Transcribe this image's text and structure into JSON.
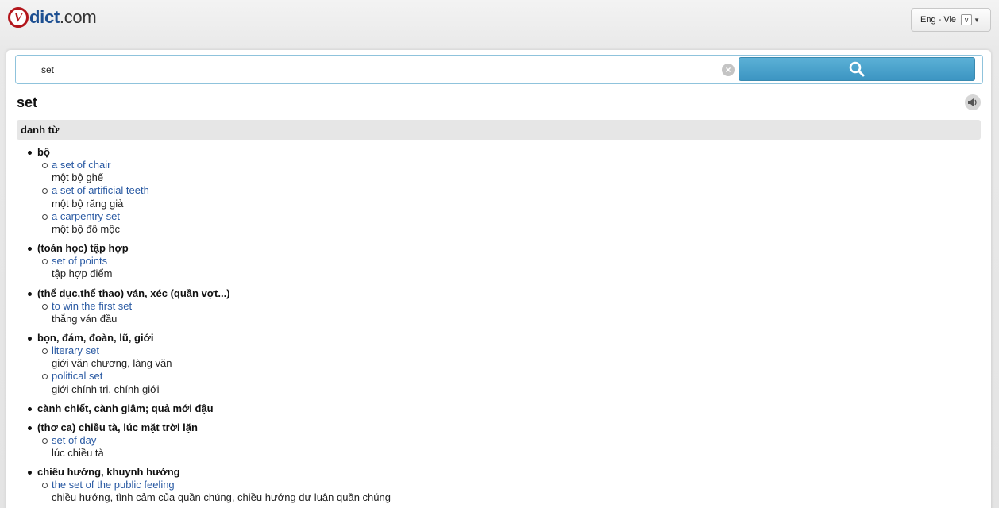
{
  "logo": {
    "v": "V",
    "dict": "dict",
    "com": ".com"
  },
  "lang": {
    "selected": "Eng - Vie",
    "arrow": "v"
  },
  "search": {
    "value": "set",
    "clear": "×"
  },
  "word": "set",
  "pos": "danh từ",
  "senses": [
    {
      "head": "bộ",
      "examples": [
        {
          "en": "a set of chair",
          "vi": "một bộ ghế"
        },
        {
          "en": "a set of artificial teeth",
          "vi": "một bộ răng giả"
        },
        {
          "en": "a carpentry set",
          "vi": "một bộ đồ mộc"
        }
      ]
    },
    {
      "head": "(toán học) tập hợp",
      "examples": [
        {
          "en": "set of points",
          "vi": "tập hợp điểm"
        }
      ]
    },
    {
      "head": "(thể dục,thể thao) ván, xéc (quần vợt...)",
      "examples": [
        {
          "en": "to win the first set",
          "vi": "thắng ván đầu"
        }
      ]
    },
    {
      "head": "bọn, đám, đoàn, lũ, giới",
      "examples": [
        {
          "en": "literary set",
          "vi": "giới văn chương, làng văn"
        },
        {
          "en": "political set",
          "vi": "giới chính trị, chính giới"
        }
      ]
    },
    {
      "head": "cành chiết, cành giâm; quả mới đậu",
      "examples": []
    },
    {
      "head": "(thơ ca) chiều tà, lúc mặt trời lặn",
      "examples": [
        {
          "en": "set of day",
          "vi": "lúc chiều tà"
        }
      ]
    },
    {
      "head": "chiều hướng, khuynh hướng",
      "examples": [
        {
          "en": "the set of the public feeling",
          "vi": "chiều hướng, tình cảm của quần chúng, chiều hướng dư luận quần chúng"
        }
      ]
    }
  ]
}
